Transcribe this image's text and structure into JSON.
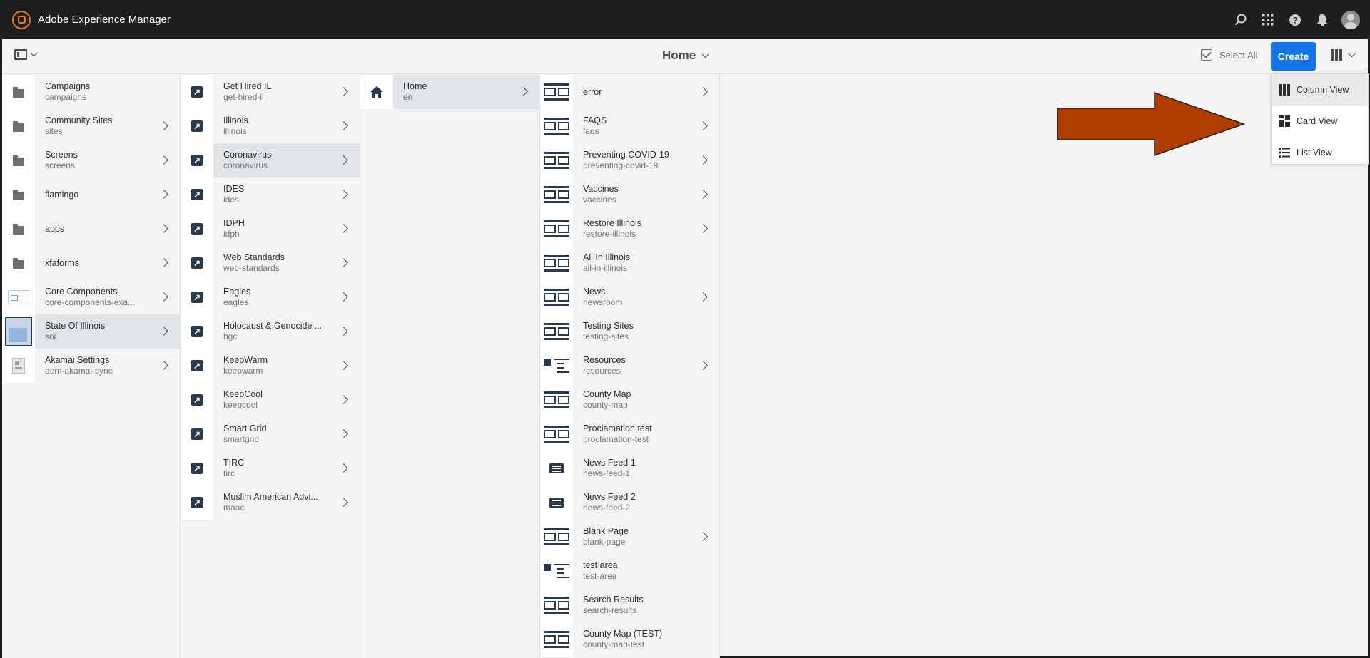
{
  "shell": {
    "title": "Adobe Experience Manager",
    "icons": [
      "search-icon",
      "apps-grid-icon",
      "help-icon",
      "bell-icon",
      "avatar"
    ]
  },
  "actionbar": {
    "title": "Home",
    "select_all": "Select All",
    "create": "Create"
  },
  "view_menu": {
    "items": [
      {
        "label": "Column View",
        "icon": "column-view-icon",
        "active": true
      },
      {
        "label": "Card View",
        "icon": "card-view-icon",
        "active": false
      },
      {
        "label": "List View",
        "icon": "list-view-icon",
        "active": false
      }
    ]
  },
  "columns": [
    {
      "items": [
        {
          "name": "Campaigns",
          "sub": "campaigns",
          "icon": "folder-icon",
          "arrow": false
        },
        {
          "name": "Community Sites",
          "sub": "sites",
          "icon": "folder-icon",
          "arrow": true
        },
        {
          "name": "Screens",
          "sub": "screens",
          "icon": "folder-icon",
          "arrow": true
        },
        {
          "name": "flamingo",
          "sub": "",
          "icon": "folder-icon",
          "arrow": true
        },
        {
          "name": "apps",
          "sub": "",
          "icon": "folder-icon",
          "arrow": true
        },
        {
          "name": "xfaforms",
          "sub": "",
          "icon": "folder-icon",
          "arrow": true
        },
        {
          "name": "Core Components",
          "sub": "core-components-exa...",
          "icon": "component-thumb-icon",
          "arrow": true
        },
        {
          "name": "State Of Illinois",
          "sub": "soi",
          "icon": "site-thumb-icon",
          "arrow": true,
          "selected": true
        },
        {
          "name": "Akamai Settings",
          "sub": "aem-akamai-sync",
          "icon": "settings-thumb-icon",
          "arrow": true
        }
      ]
    },
    {
      "items": [
        {
          "name": "Get Hired IL",
          "sub": "get-hired-il",
          "icon": "link-icon",
          "arrow": true
        },
        {
          "name": "Illinois",
          "sub": "illinois",
          "icon": "link-icon",
          "arrow": true
        },
        {
          "name": "Coronavirus",
          "sub": "coronavirus",
          "icon": "link-icon",
          "arrow": true,
          "selected": true
        },
        {
          "name": "IDES",
          "sub": "ides",
          "icon": "link-icon",
          "arrow": true
        },
        {
          "name": "IDPH",
          "sub": "idph",
          "icon": "link-icon",
          "arrow": true
        },
        {
          "name": "Web Standards",
          "sub": "web-standards",
          "icon": "link-icon",
          "arrow": true
        },
        {
          "name": "Eagles",
          "sub": "eagles",
          "icon": "link-icon",
          "arrow": true
        },
        {
          "name": "Holocaust & Genocide ...",
          "sub": "hgc",
          "icon": "link-icon",
          "arrow": true
        },
        {
          "name": "KeepWarm",
          "sub": "keepwarm",
          "icon": "link-icon",
          "arrow": true
        },
        {
          "name": "KeepCool",
          "sub": "keepcool",
          "icon": "link-icon",
          "arrow": true
        },
        {
          "name": "Smart Grid",
          "sub": "smartgrid",
          "icon": "link-icon",
          "arrow": true
        },
        {
          "name": "TIRC",
          "sub": "tirc",
          "icon": "link-icon",
          "arrow": true
        },
        {
          "name": "Muslim American Advi...",
          "sub": "maac",
          "icon": "link-icon",
          "arrow": true
        }
      ]
    },
    {
      "items": [
        {
          "name": "Home",
          "sub": "en",
          "icon": "home-icon",
          "arrow": true,
          "selected": true
        }
      ]
    },
    {
      "items": [
        {
          "name": "error",
          "sub": "",
          "icon": "page-icon",
          "arrow": true
        },
        {
          "name": "FAQS",
          "sub": "faqs",
          "icon": "page-icon",
          "arrow": true
        },
        {
          "name": "Preventing COVID-19",
          "sub": "preventing-covid-19",
          "icon": "page-icon",
          "arrow": true
        },
        {
          "name": "Vaccines",
          "sub": "vaccines",
          "icon": "page-icon",
          "arrow": true
        },
        {
          "name": "Restore Illinois",
          "sub": "restore-illinois",
          "icon": "page-icon",
          "arrow": true
        },
        {
          "name": "All In Illinois",
          "sub": "all-in-illinois",
          "icon": "page-icon",
          "arrow": false
        },
        {
          "name": "News",
          "sub": "newsroom",
          "icon": "page-icon",
          "arrow": true
        },
        {
          "name": "Testing Sites",
          "sub": "testing-sites",
          "icon": "page-icon",
          "arrow": false
        },
        {
          "name": "Resources",
          "sub": "resources",
          "icon": "resources-page-icon",
          "arrow": true
        },
        {
          "name": "County Map",
          "sub": "county-map",
          "icon": "page-icon",
          "arrow": false
        },
        {
          "name": "Proclamation test",
          "sub": "proclamation-test",
          "icon": "page-icon",
          "arrow": false
        },
        {
          "name": "News Feed 1",
          "sub": "news-feed-1",
          "icon": "news-feed-icon",
          "arrow": false
        },
        {
          "name": "News Feed 2",
          "sub": "news-feed-2",
          "icon": "news-feed-icon",
          "arrow": false
        },
        {
          "name": "Blank Page",
          "sub": "blank-page",
          "icon": "page-icon",
          "arrow": true
        },
        {
          "name": "test area",
          "sub": "test-area",
          "icon": "resources-page-icon",
          "arrow": false
        },
        {
          "name": "Search Results",
          "sub": "search-results",
          "icon": "page-icon",
          "arrow": false
        },
        {
          "name": "County Map (TEST)",
          "sub": "county-map-test",
          "icon": "page-icon",
          "arrow": false
        }
      ]
    }
  ],
  "colors": {
    "shell_bg": "#1e1e1e",
    "create_blue": "#1473e6",
    "selected_row": "#e1e5ea",
    "annotation_arrow": "#b03d00"
  }
}
